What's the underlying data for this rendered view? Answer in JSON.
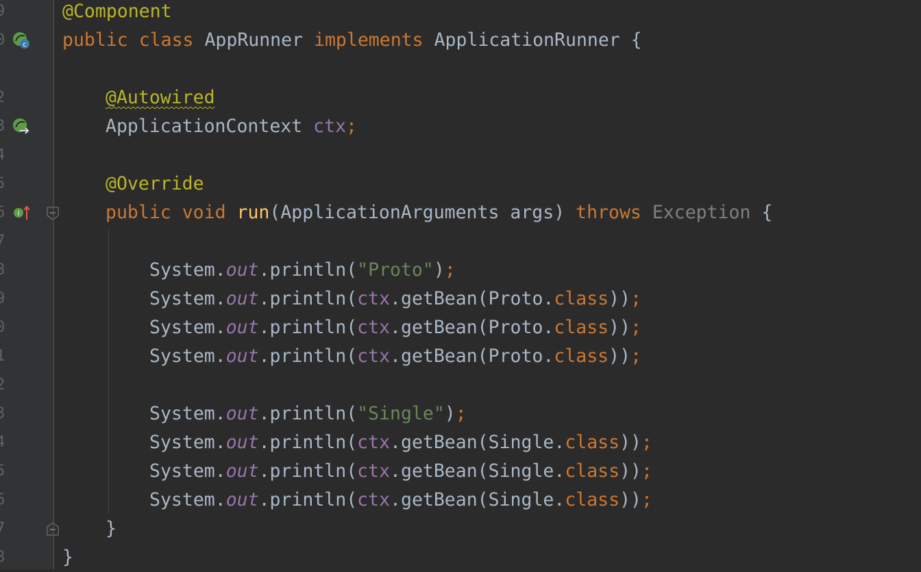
{
  "code": {
    "l1_annotation": "@Component",
    "l2_public": "public",
    "l2_class": "class",
    "l2_name": "AppRunner",
    "l2_implements": "implements",
    "l2_iface": "ApplicationRunner",
    "l2_brace": "{",
    "l4_annotation": "@Autowired",
    "l5_type": "ApplicationContext",
    "l5_field": "ctx",
    "l5_semi": ";",
    "l7_annotation": "@Override",
    "l8_public": "public",
    "l8_void": "void",
    "l8_method": "run",
    "l8_params": "(ApplicationArguments args)",
    "l8_throws": "throws",
    "l8_exception": "Exception",
    "l8_brace": "{",
    "system": "System.",
    "out": "out",
    "println_open": ".println(",
    "str_proto": "\"Proto\"",
    "str_single": "\"Single\"",
    "close_semi": ")",
    "semi": ";",
    "ctx": "ctx",
    "getbean_proto": ".getBean(Proto.",
    "getbean_single": ".getBean(Single.",
    "class_kw": "class",
    "close_double": "))",
    "method_close": "}",
    "class_close": "}"
  }
}
